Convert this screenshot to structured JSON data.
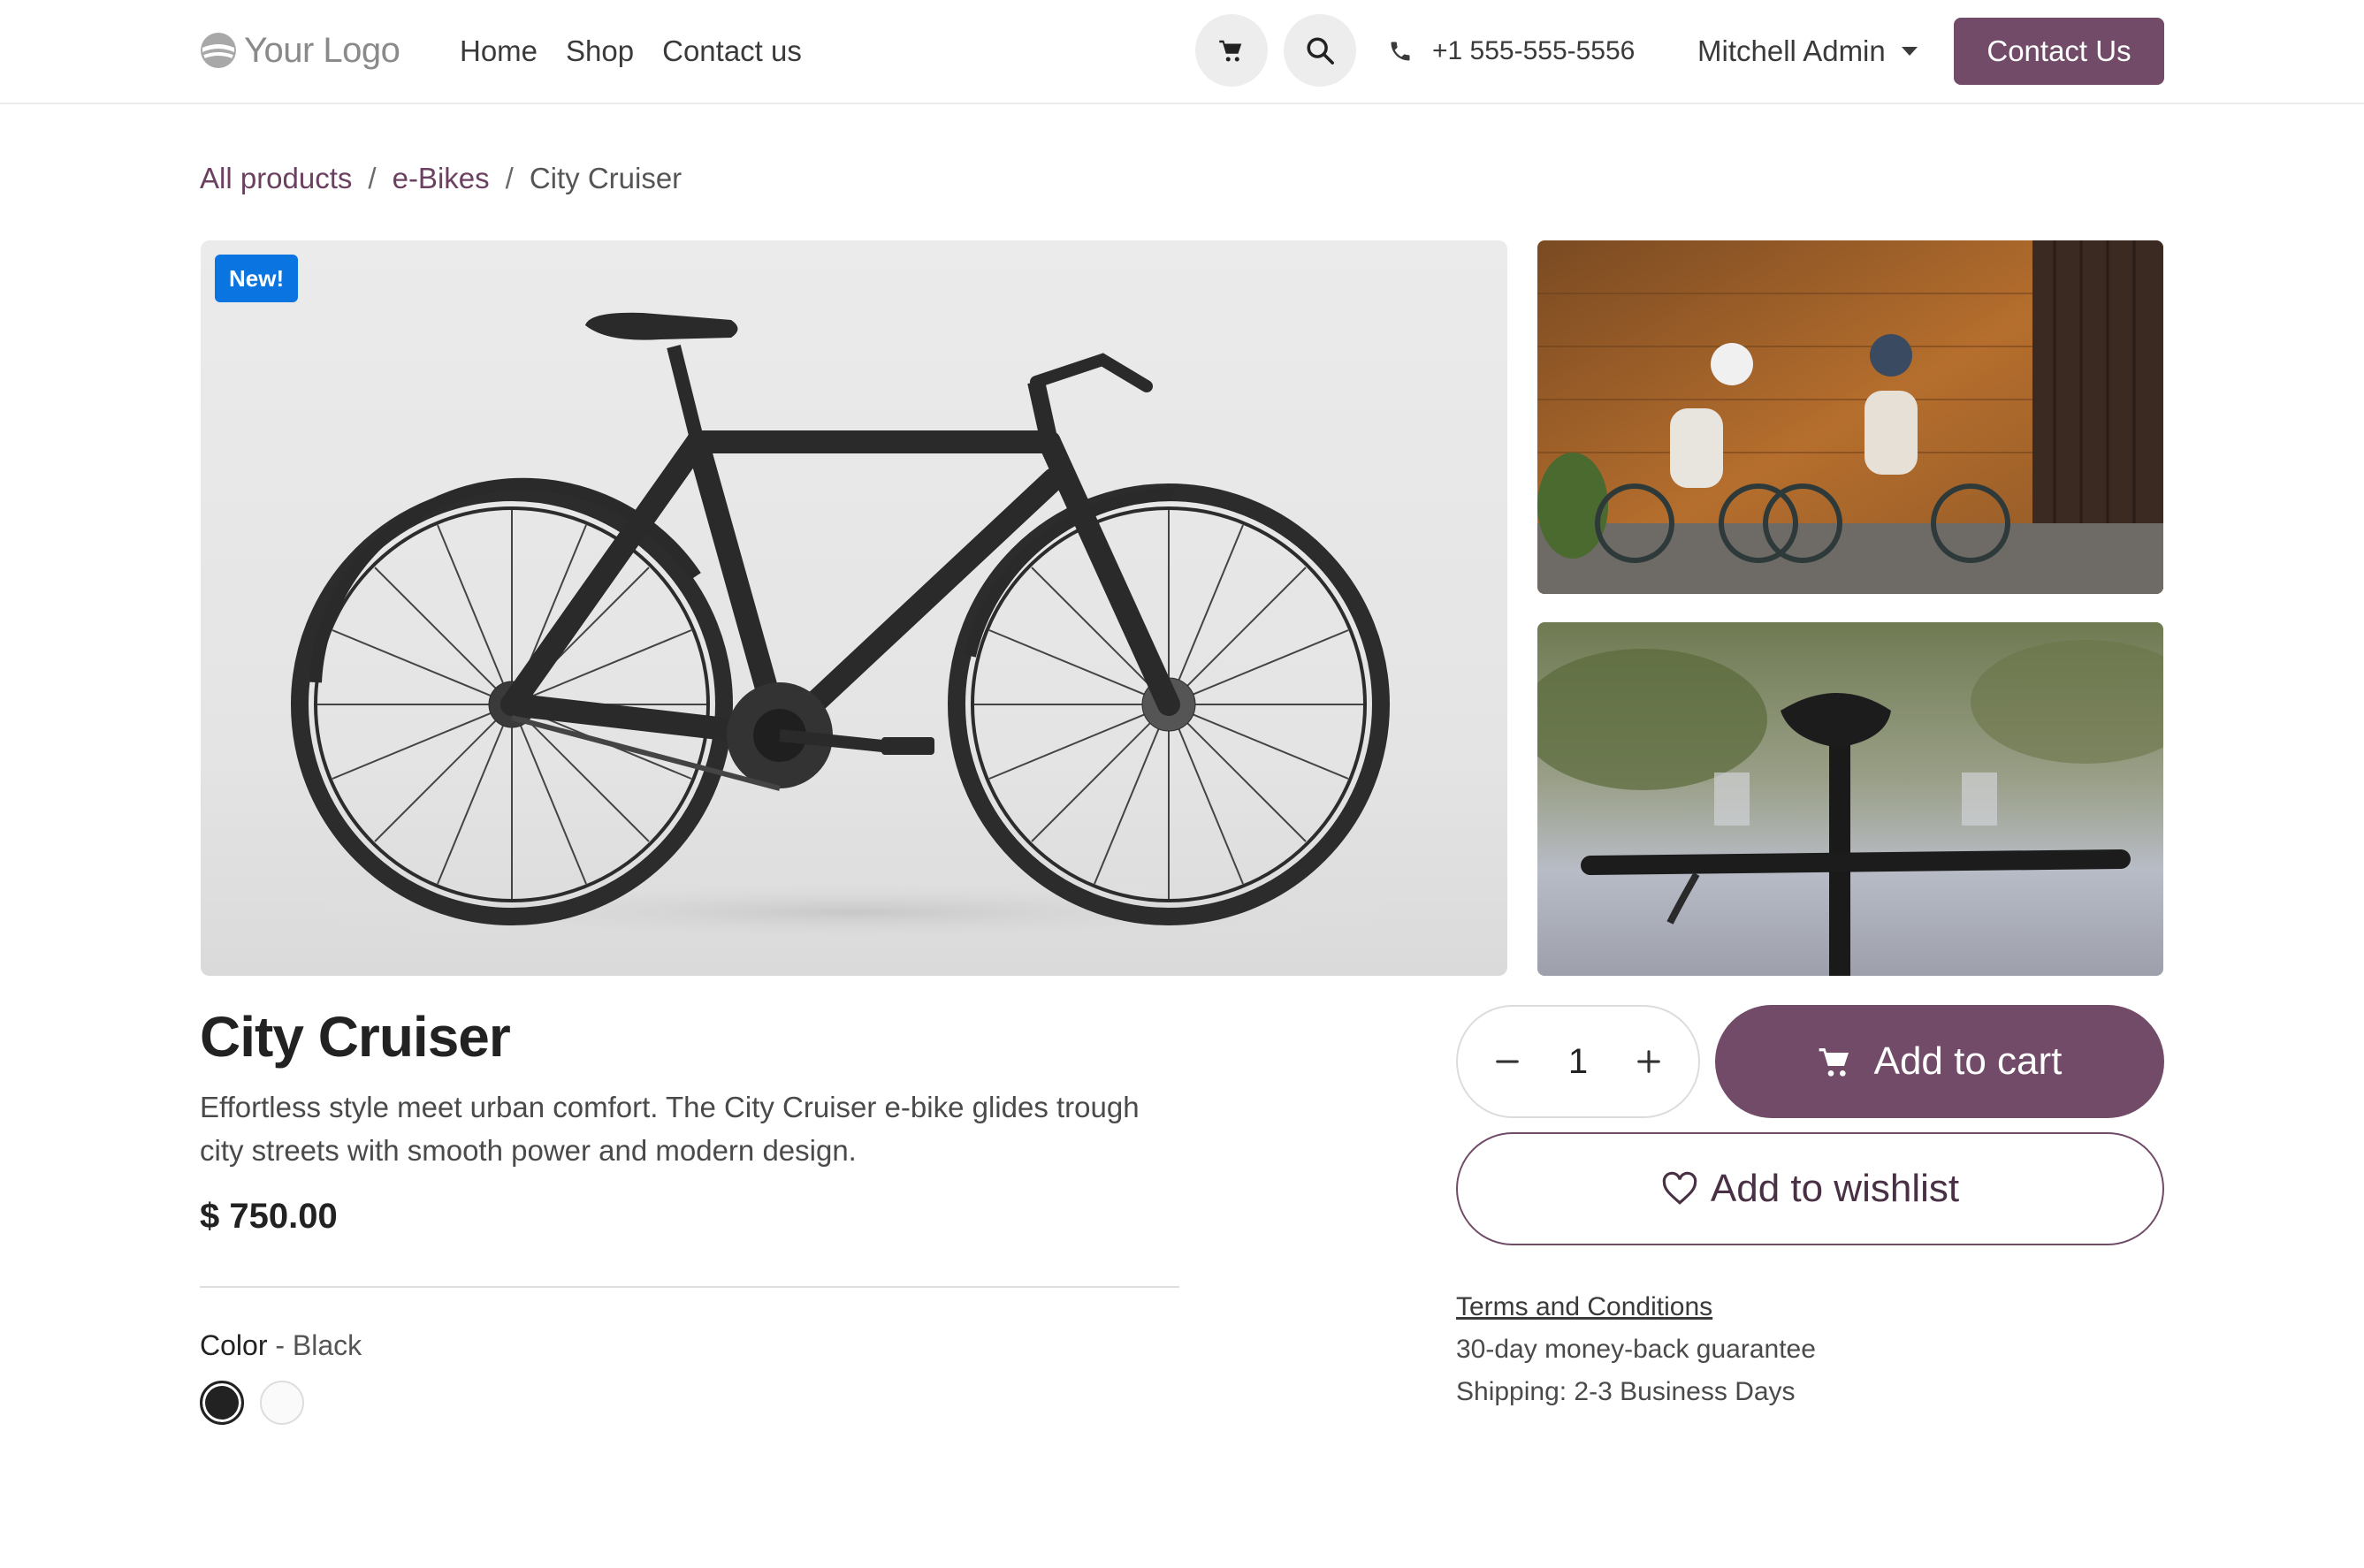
{
  "header": {
    "logo_text": "Your Logo",
    "nav": [
      "Home",
      "Shop",
      "Contact us"
    ],
    "phone": "+1 555-555-5556",
    "user": "Mitchell Admin",
    "contact_button": "Contact Us"
  },
  "breadcrumb": {
    "items": [
      "All products",
      "e-Bikes"
    ],
    "current": "City Cruiser",
    "separator": "/"
  },
  "product": {
    "badge": "New!",
    "name": "City Cruiser",
    "description": "Effortless style meet urban comfort. The City Cruiser e-bike glides trough city streets with smooth power and modern design.",
    "price": "$ 750.00",
    "color_label": "Color",
    "color_value": "- Black",
    "colors": [
      "#222222",
      "#fafafa"
    ],
    "quantity": "1"
  },
  "actions": {
    "add_to_cart": "Add to cart",
    "add_to_wishlist": "Add to wishlist"
  },
  "info": {
    "terms": "Terms and Conditions",
    "guarantee": "30-day money-back guarantee",
    "shipping": "Shipping: 2-3 Business Days"
  },
  "theme": {
    "primary": "#714b67",
    "badge": "#0a74e0"
  },
  "icons": [
    "cart-icon",
    "search-icon",
    "phone-icon",
    "heart-icon",
    "minus-icon",
    "plus-icon"
  ]
}
